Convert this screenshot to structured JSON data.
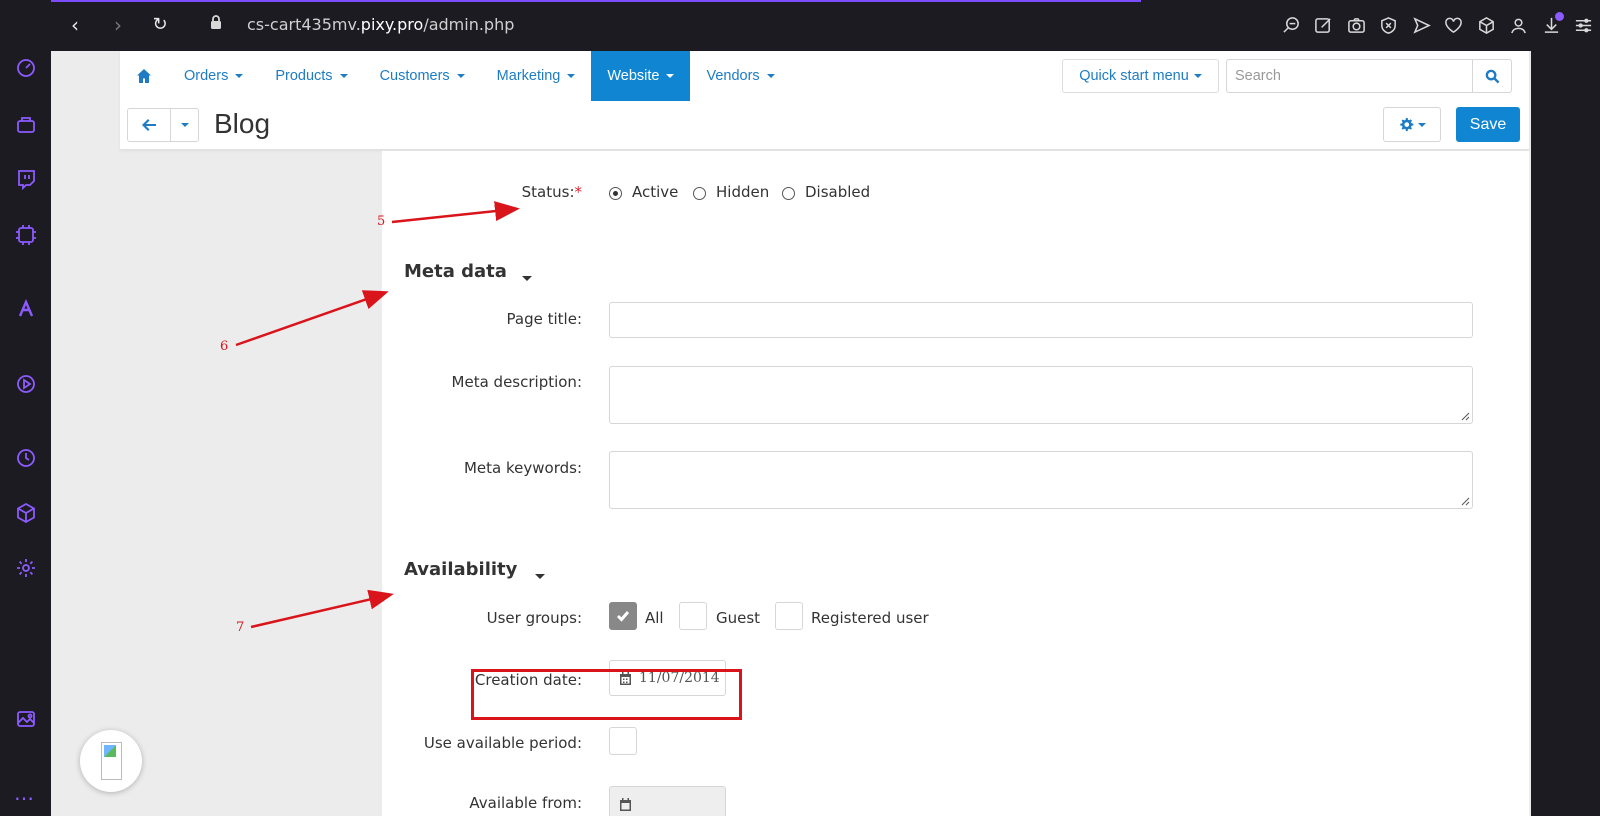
{
  "browser": {
    "url_prefix": "cs-cart435mv.",
    "url_domain": "pixy.pro",
    "url_path": "/admin.php"
  },
  "sidebar_icons": [
    "speed-dial-icon",
    "bag-icon",
    "twitch-icon",
    "chip-icon",
    "aria-icon",
    "player-icon",
    "history-icon",
    "cube-icon",
    "settings-icon",
    "gallery-icon"
  ],
  "toolbar_icons": [
    "zoom-icon",
    "edit-icon",
    "camera-icon",
    "shield-icon",
    "send-icon",
    "heart-icon",
    "box-icon",
    "profile-icon",
    "download-icon",
    "menu-icon"
  ],
  "nav": {
    "items": [
      {
        "label": "Orders"
      },
      {
        "label": "Products"
      },
      {
        "label": "Customers"
      },
      {
        "label": "Marketing"
      },
      {
        "label": "Website"
      },
      {
        "label": "Vendors"
      }
    ],
    "active": "Website",
    "quick_start": "Quick start menu",
    "search_placeholder": "Search"
  },
  "page": {
    "title": "Blog",
    "save_label": "Save"
  },
  "form": {
    "status_label": "Status:",
    "required_mark": "*",
    "status_options": [
      "Active",
      "Hidden",
      "Disabled"
    ],
    "status_selected": "Active",
    "meta_section": "Meta data",
    "page_title_label": "Page title:",
    "page_title_value": "",
    "meta_description_label": "Meta description:",
    "meta_description_value": "",
    "meta_keywords_label": "Meta keywords:",
    "meta_keywords_value": "",
    "availability_section": "Availability",
    "user_groups_label": "User groups:",
    "user_groups": [
      {
        "label": "All",
        "checked": true
      },
      {
        "label": "Guest",
        "checked": false
      },
      {
        "label": "Registered user",
        "checked": false
      }
    ],
    "creation_date_label": "Creation date:",
    "creation_date_value": "11/07/2014",
    "use_period_label": "Use available period:",
    "available_from_label": "Available from:"
  },
  "annotations": {
    "five": "5",
    "six": "6",
    "seven": "7"
  },
  "colors": {
    "accent": "#1086d2",
    "link": "#1e7cc5",
    "annotation_red": "#d9141b",
    "browser_dark": "#1c1b22",
    "sidebar_purple": "#8c5bff"
  }
}
